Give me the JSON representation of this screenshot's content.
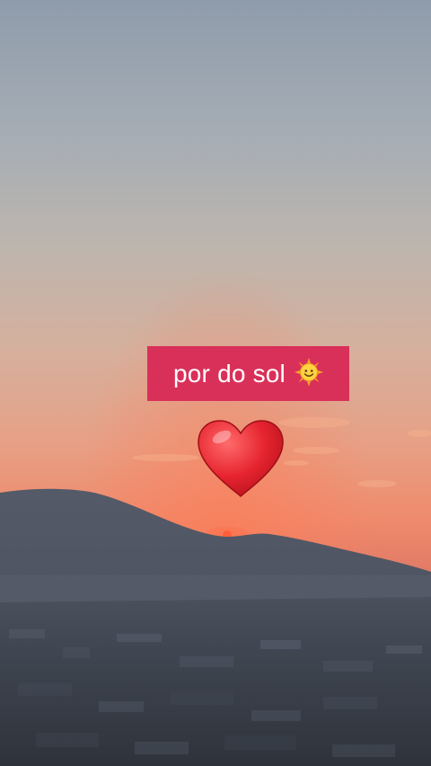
{
  "caption": {
    "text": "por do sol",
    "background": "#d9305a",
    "text_color": "#ffffff",
    "emoji": "smiling-sun-emoji"
  },
  "sticker": {
    "icon": "red-heart-icon",
    "color": "#e6242f"
  },
  "scene": {
    "sky_top": "#8c9bab",
    "sky_mid": "#c9b3a6",
    "sky_horizon": "#f08a6d",
    "mountain": "#4f5664",
    "city": "#3a404b",
    "sun": "#ff4a2a"
  }
}
